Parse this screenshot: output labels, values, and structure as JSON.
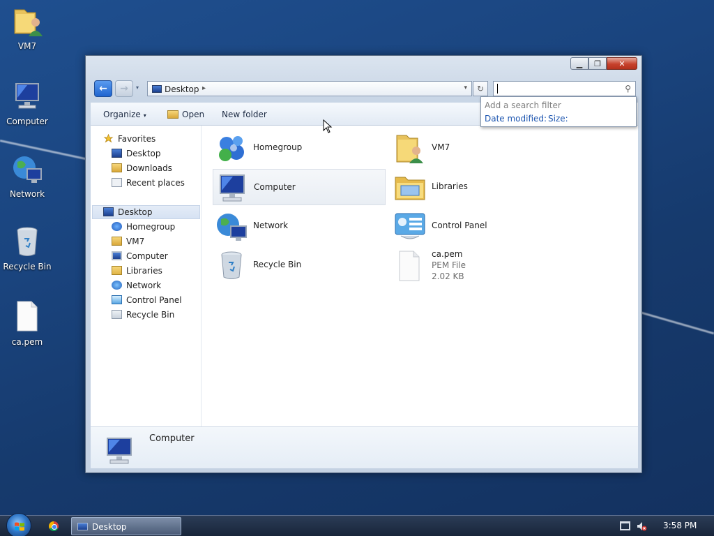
{
  "desktop": {
    "icons": [
      {
        "label": "VM7",
        "icon": "user-folder-icon"
      },
      {
        "label": "Computer",
        "icon": "computer-icon"
      },
      {
        "label": "Network",
        "icon": "network-icon"
      },
      {
        "label": "Recycle Bin",
        "icon": "recycle-bin-icon"
      },
      {
        "label": "ca.pem",
        "icon": "file-icon"
      }
    ]
  },
  "window": {
    "controls": {
      "minimize": "▁",
      "maximize": "❐",
      "close": "✕"
    },
    "nav": {
      "back": "←",
      "forward": "→",
      "recent": "▾"
    },
    "address": {
      "location": "Desktop",
      "separator": "▸",
      "dropdown": "▾"
    },
    "refresh": "↻",
    "search": {
      "placeholder": "",
      "glyph": "⚲"
    },
    "search_popup": {
      "title": "Add a search filter",
      "filter_date": "Date modified:",
      "filter_size": "Size:"
    },
    "toolbar": {
      "organize": "Organize",
      "open": "Open",
      "new_folder": "New folder",
      "caret": "▾"
    },
    "nav_pane": {
      "favorites": "Favorites",
      "favorites_items": [
        "Desktop",
        "Downloads",
        "Recent places"
      ],
      "desktop": "Desktop",
      "desktop_items": [
        "Homegroup",
        "VM7",
        "Computer",
        "Libraries",
        "Network",
        "Control Panel",
        "Recycle Bin"
      ]
    },
    "content": {
      "items": [
        {
          "label": "Homegroup",
          "icon": "homegroup-icon"
        },
        {
          "label": "VM7",
          "icon": "user-folder-icon"
        },
        {
          "label": "Computer",
          "icon": "computer-icon"
        },
        {
          "label": "Libraries",
          "icon": "libraries-icon"
        },
        {
          "label": "Network",
          "icon": "network-icon"
        },
        {
          "label": "Control Panel",
          "icon": "control-panel-icon"
        },
        {
          "label": "Recycle Bin",
          "icon": "recycle-bin-icon"
        },
        {
          "label": "ca.pem",
          "type": "PEM File",
          "size": "2.02 KB",
          "icon": "file-icon"
        }
      ]
    },
    "details": {
      "name": "Computer",
      "icon": "computer-icon"
    }
  },
  "taskbar": {
    "task_label": "Desktop",
    "clock": "3:58 PM"
  },
  "colors": {
    "desktop": "#1a447e",
    "link": "#1e56b0",
    "close": "#c7422d"
  }
}
